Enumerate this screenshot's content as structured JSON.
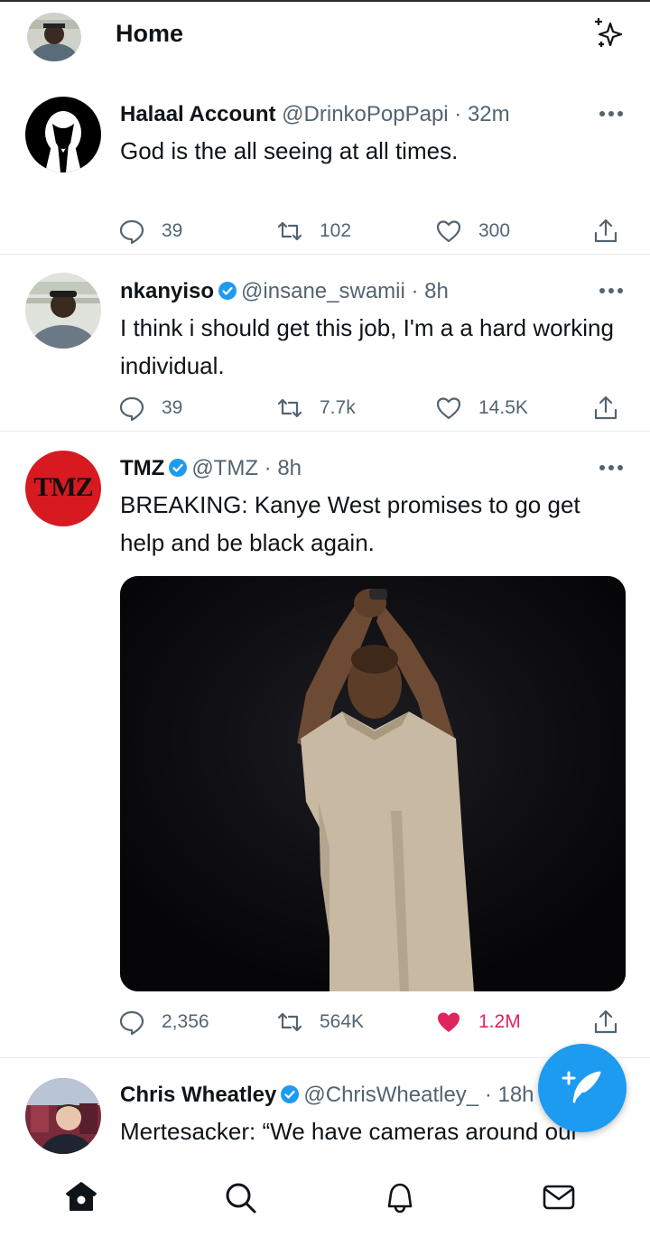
{
  "header": {
    "title": "Home",
    "sparkle_icon": "sparkle-icon",
    "avatar_icon": "profile-avatar"
  },
  "tweets": [
    {
      "name": "Halaal Account",
      "handle": "@DrinkoPopPapi",
      "time": "· 32m",
      "verified": false,
      "text": "God is the all seeing at all times.",
      "replies": "39",
      "retweets": "102",
      "likes": "300",
      "liked": false
    },
    {
      "name": "nkanyiso",
      "handle": "@insane_swamii",
      "time": "· 8h",
      "verified": true,
      "text": "I think i should get this job, I'm a a hard working individual.",
      "replies": "39",
      "retweets": "7.7k",
      "likes": "14.5K",
      "liked": false
    },
    {
      "name": "TMZ",
      "handle": "@TMZ",
      "time": "· 8h",
      "verified": true,
      "avatar_text": "TMZ",
      "text": "BREAKING: Kanye West promises to go get help and be black again.",
      "replies": "2,356",
      "retweets": "564K",
      "likes": "1.2M",
      "liked": true
    },
    {
      "name": "Chris Wheatley",
      "handle": "@ChrisWheatley_",
      "time": "· 18h",
      "verified": true,
      "text": "Mertesacker: “We have cameras around our"
    }
  ],
  "colors": {
    "accent": "#1d9bf0",
    "like": "#e0245e",
    "tmz_red": "#d71920",
    "secondary_text": "#536471"
  },
  "nav": [
    "home-icon",
    "search-icon",
    "notifications-icon",
    "messages-icon"
  ],
  "fab": {
    "icon": "compose-tweet-icon"
  }
}
